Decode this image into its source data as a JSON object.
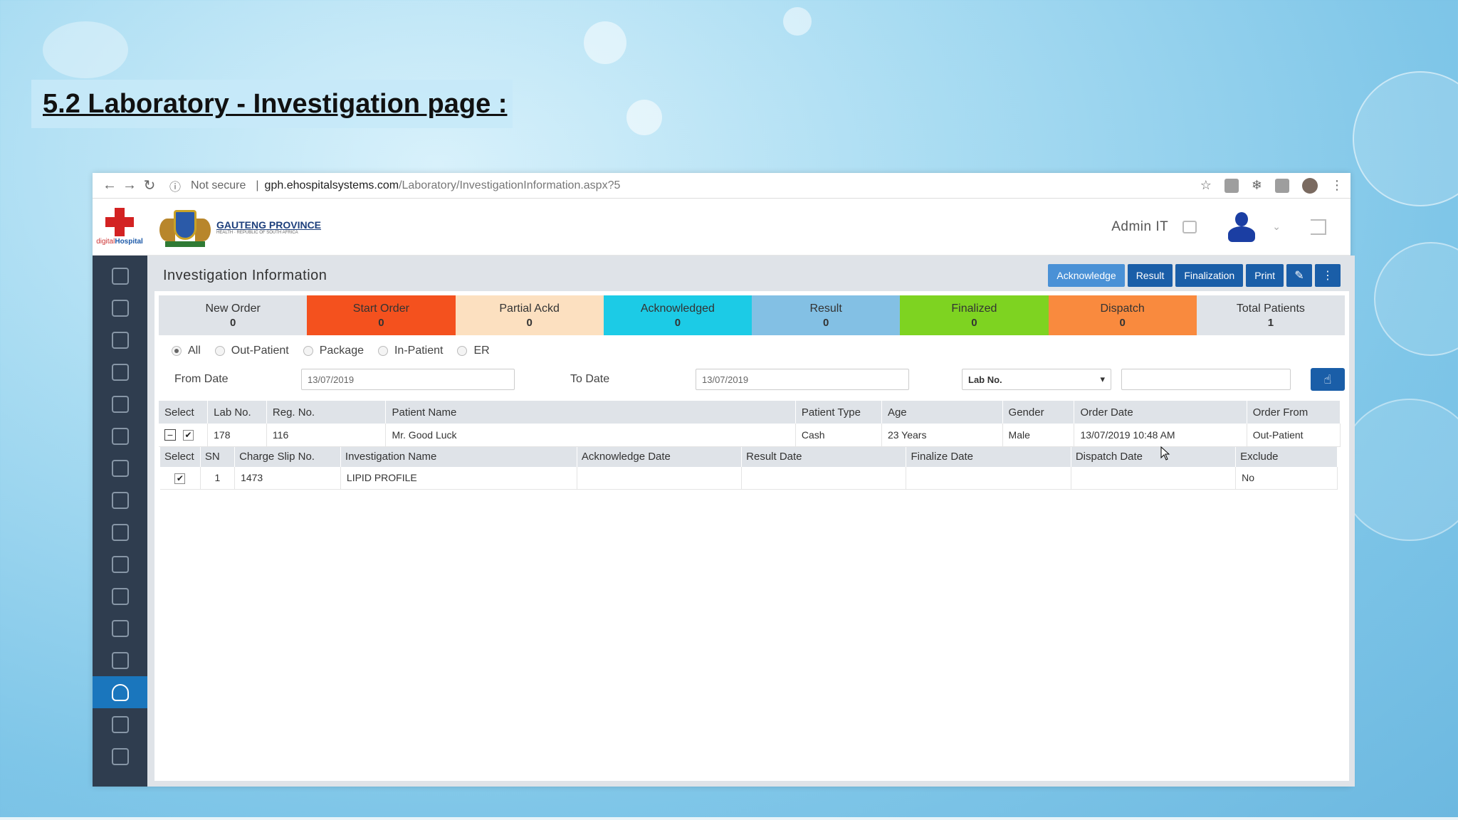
{
  "slide": {
    "title": "5.2 Laboratory - Investigation page :"
  },
  "browser": {
    "security": "Not secure",
    "url_host": "gph.ehospitalsystems.com",
    "url_path": "/Laboratory/InvestigationInformation.aspx?5"
  },
  "header": {
    "app_logo_text_1": "digital",
    "app_logo_text_2": "Hospital",
    "org_name": "GAUTENG PROVINCE",
    "org_sub": "HEALTH · REPUBLIC OF SOUTH AFRICA",
    "user_name": "Admin IT"
  },
  "sidebar": {
    "items": [
      "home-icon",
      "hospital-icon",
      "reception-icon",
      "emergency-icon",
      "walking-patient-icon",
      "bed-icon",
      "ward-icon",
      "doctor-icon",
      "head-icon",
      "nurse-icon",
      "billing-icon",
      "pharmacist-icon",
      "surgical-icon",
      "laboratory-icon",
      "blood-bank-icon",
      "inventory-icon"
    ],
    "active_index": 13
  },
  "page": {
    "title": "Investigation Information",
    "toolbar": {
      "acknowledge": "Acknowledge",
      "result": "Result",
      "finalization": "Finalization",
      "print": "Print"
    }
  },
  "status": [
    {
      "label": "New Order",
      "count": "0",
      "color": "#dfe3e8"
    },
    {
      "label": "Start Order",
      "count": "0",
      "color": "#f4511e"
    },
    {
      "label": "Partial Ackd",
      "count": "0",
      "color": "#fce0c0"
    },
    {
      "label": "Acknowledged",
      "count": "0",
      "color": "#1ccbe6"
    },
    {
      "label": "Result",
      "count": "0",
      "color": "#83c0e4"
    },
    {
      "label": "Finalized",
      "count": "0",
      "color": "#7ed321"
    },
    {
      "label": "Dispatch",
      "count": "0",
      "color": "#f98a3e"
    },
    {
      "label": "Total Patients",
      "count": "1",
      "color": "#dfe3e8"
    }
  ],
  "filters": {
    "patient_types": [
      "All",
      "Out-Patient",
      "Package",
      "In-Patient",
      "ER"
    ],
    "selected": "All",
    "from_label": "From Date",
    "from_value": "13/07/2019",
    "to_label": "To Date",
    "to_value": "13/07/2019",
    "search_by": "Lab No.",
    "search_value": ""
  },
  "patients_table": {
    "headers": [
      "Select",
      "Lab No.",
      "Reg. No.",
      "Patient Name",
      "Patient Type",
      "Age",
      "Gender",
      "Order Date",
      "Order From"
    ],
    "rows": [
      {
        "lab_no": "178",
        "reg_no": "116",
        "name": "Mr. Good Luck",
        "type": "Cash",
        "age": "23 Years",
        "gender": "Male",
        "order_date": "13/07/2019 10:48 AM",
        "order_from": "Out-Patient"
      }
    ]
  },
  "investigations_table": {
    "headers": [
      "Select",
      "SN",
      "Charge Slip No.",
      "Investigation Name",
      "Acknowledge Date",
      "Result Date",
      "Finalize Date",
      "Dispatch Date",
      "Exclude"
    ],
    "rows": [
      {
        "sn": "1",
        "charge_slip": "1473",
        "name": "LIPID PROFILE",
        "ack_date": "",
        "result_date": "",
        "finalize_date": "",
        "dispatch_date": "",
        "exclude": "No"
      }
    ]
  }
}
